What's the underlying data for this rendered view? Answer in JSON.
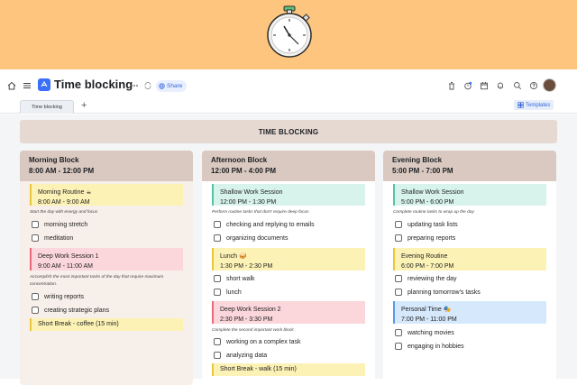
{
  "app": {
    "title": "Time blocking",
    "share_label": "Share",
    "templates_label": "Templates"
  },
  "tabs": [
    {
      "label": "Time blocking"
    }
  ],
  "board": {
    "header": "TIME BLOCKING"
  },
  "columns": [
    {
      "name": "Morning Block",
      "time": "8:00 AM - 12:00 PM",
      "blocks": [
        {
          "title": "Morning Routine ☕",
          "time": "8:00 AM - 9:00 AM",
          "color": "yellow"
        },
        {
          "title": "Deep Work Session 1",
          "time": "9:00 AM - 11:00 AM",
          "color": "red"
        },
        {
          "title": "Short Break - coffee (15 min)",
          "time": "",
          "color": "yellow"
        }
      ],
      "notes": [
        "Start the day with energy and focus",
        "Accomplish the most important tasks of the day that require maximum concentration."
      ],
      "tasks": [
        "morning stretch",
        "meditation",
        "writing reports",
        "creating strategic plans"
      ]
    },
    {
      "name": "Afternoon Block",
      "time": "12:00 PM - 4:00 PM",
      "blocks": [
        {
          "title": "Shallow Work Session",
          "time": "12:00 PM - 1:30 PM",
          "color": "green"
        },
        {
          "title": "Lunch 🥪",
          "time": "1:30 PM - 2:30 PM",
          "color": "yellow"
        },
        {
          "title": "Deep Work Session 2",
          "time": "2:30 PM - 3:30 PM",
          "color": "red"
        },
        {
          "title": "Short Break - walk (15 min)",
          "time": "",
          "color": "yellow"
        }
      ],
      "notes": [
        "Perform routine tasks that don't require deep focus",
        "Complete the second important work block"
      ],
      "tasks": [
        "checking and replying to emails",
        "organizing documents",
        "short walk",
        "lunch",
        "working on a complex task",
        "analyzing data"
      ]
    },
    {
      "name": "Evening Block",
      "time": "5:00 PM - 7:00 PM",
      "blocks": [
        {
          "title": "Shallow Work Session",
          "time": "5:00 PM - 6:00 PM",
          "color": "green"
        },
        {
          "title": "Evening Routine",
          "time": "6:00 PM - 7:00 PM",
          "color": "yellow"
        },
        {
          "title": "Personal Time 🎭",
          "time": "7:00 PM - 11:00 PM",
          "color": "blue"
        }
      ],
      "notes": [
        "Complete routine tasks to wrap up the day"
      ],
      "tasks": [
        "updating task lists",
        "preparing reports",
        "reviewing the day",
        "planning tomorrow's tasks",
        "watching movies",
        "engaging in hobbies"
      ]
    }
  ],
  "icons": {
    "banner": "stopwatch-icon",
    "nav": [
      "home-icon",
      "menu-icon",
      "doc-icon",
      "more-icon",
      "sync-icon",
      "globe-icon"
    ],
    "toolbar_right": [
      "trash-icon",
      "timer-icon",
      "calendar-icon",
      "bell-icon",
      "search-icon",
      "help-icon"
    ]
  },
  "colors": {
    "banner": "#fdc57e",
    "accent": "#3a6ff7",
    "column_header": "#d9c9c0"
  }
}
